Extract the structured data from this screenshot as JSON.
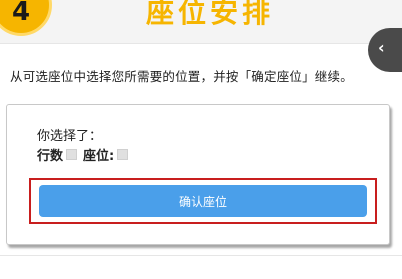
{
  "header": {
    "step_number": "4",
    "title": "座位安排",
    "back_glyph": "‹",
    "back_icon": "chevron-left-icon"
  },
  "instruction": "从可选座位中选择您所需要的位置，并按「确定座位」继续。",
  "selection": {
    "heading": "你选择了：",
    "row_label": "行数",
    "seat_label": "座位:"
  },
  "confirm_button_label": "确认座位",
  "colors": {
    "accent_yellow": "#f6b500",
    "button_blue": "#4a9fea",
    "highlight_red": "#c81e1e"
  }
}
